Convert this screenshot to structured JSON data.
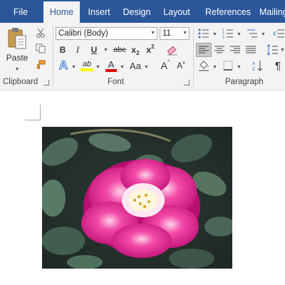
{
  "tabs": [
    "File",
    "Home",
    "Insert",
    "Design",
    "Layout",
    "References",
    "Mailing"
  ],
  "active_tab": "Home",
  "clipboard": {
    "paste_label": "Paste",
    "group_label": "Clipboard"
  },
  "font": {
    "family_value": "Calibri (Body)",
    "size_value": "11",
    "group_label": "Font",
    "bold": "B",
    "italic": "I",
    "underline": "U",
    "strikethrough": "abc",
    "subscript": "x",
    "subscript_mark": "2",
    "superscript": "x",
    "superscript_mark": "2",
    "change_case": "Aa",
    "grow": "A",
    "shrink": "A",
    "text_effects": "A",
    "highlight": "ab",
    "font_color": "A"
  },
  "paragraph": {
    "group_label": "Paragraph",
    "pilcrow": "¶"
  },
  "colors": {
    "ribbon_blue": "#2b579a",
    "highlight_yellow": "#ffff00",
    "font_red": "#e00000",
    "flower_magenta": "#e0188a"
  },
  "document": {
    "image_subject": "pink rose with green leaves"
  }
}
